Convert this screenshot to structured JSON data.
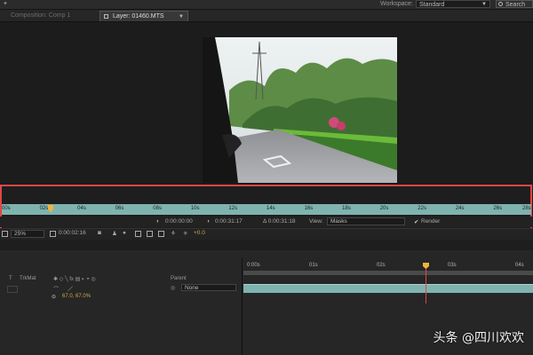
{
  "colors": {
    "accent_red": "#e04646",
    "ruler": "#7fb3b0",
    "playhead": "#f0b43a",
    "scale_value": "#d0a64d"
  },
  "topbar": {
    "workspace_label": "Workspace:",
    "workspace_value": "Standard",
    "search_text": "Search"
  },
  "tabs": {
    "composition": "Composition: Comp 1",
    "layer": "Layer: 01460.MTS"
  },
  "layer_ruler": {
    "labels": [
      "00s",
      "02s",
      "04s",
      "06s",
      "08s",
      "10s",
      "12s",
      "14s",
      "16s",
      "18s",
      "20s",
      "22s",
      "24s",
      "26s",
      "28s"
    ]
  },
  "timecodes": {
    "in": "0:00:00:00",
    "out": "0:00:31:17",
    "duration": "Δ 0:00:31:18",
    "view_label": "View:",
    "view_value": "Masks",
    "render_label": "Render"
  },
  "viewer_toolbar": {
    "zoom": "25%",
    "current_time": "0:00:02:16",
    "exposure": "+0.0"
  },
  "timeline": {
    "columns": {
      "t": "T",
      "trkmat": "TrkMat",
      "parent": "Parent"
    },
    "layer": {
      "parent_value": "None",
      "scale": "67.0, 67.0%"
    },
    "ruler_labels": [
      "0:00s",
      "01s",
      "02s",
      "03s",
      "04s"
    ]
  },
  "watermark": "头条 @四川欢欢"
}
